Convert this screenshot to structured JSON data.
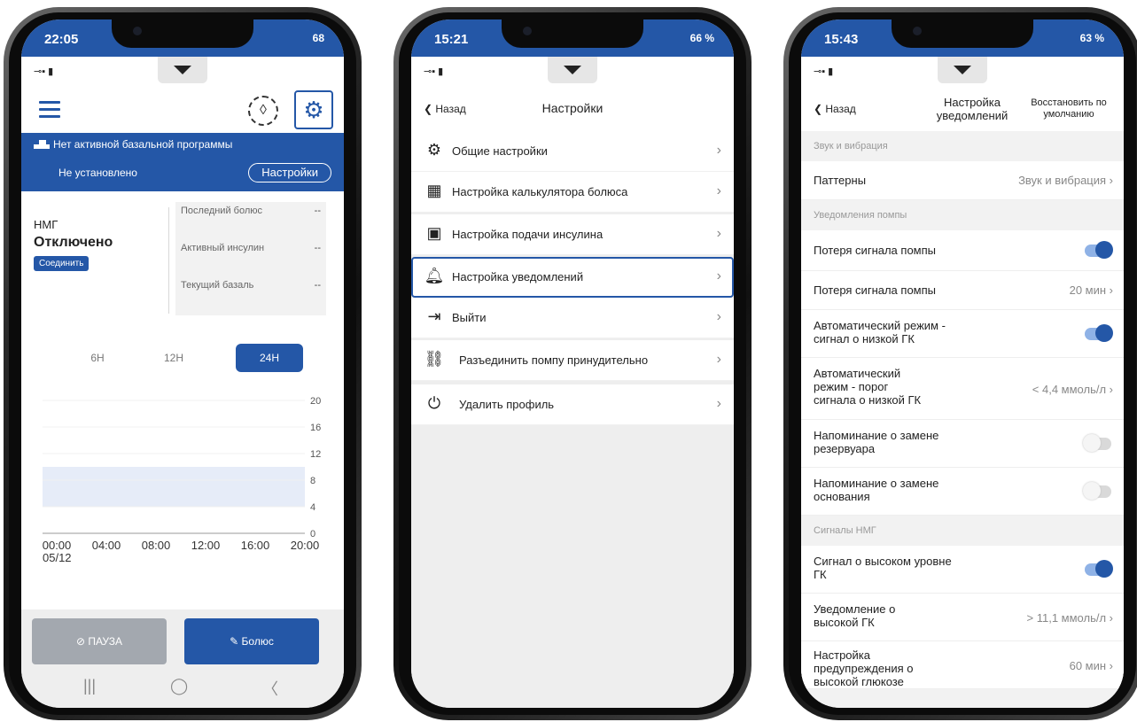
{
  "phone1": {
    "status": {
      "time": "22:05",
      "battery": "68"
    },
    "header": {
      "menu_icon": "hamburger-icon",
      "drop_icon": "drop-icon",
      "settings_icon": "gear-icon"
    },
    "banner": {
      "title": "Нет активной базальной программы",
      "status": "Не установлено",
      "button": "Настройки"
    },
    "cgm": {
      "label": "НМГ",
      "state": "Отключено",
      "connect": "Соединить"
    },
    "stats": [
      {
        "label": "Последний болюс",
        "value": "--"
      },
      {
        "label": "Активный инсулин",
        "value": "--"
      },
      {
        "label": "Текущий базаль",
        "value": "--"
      }
    ],
    "ranges": [
      "6H",
      "12H",
      "24H"
    ],
    "active_range": "24H",
    "buttons": {
      "pause": "ПАУЗА",
      "bolus": "Болюс"
    }
  },
  "chart_data": {
    "type": "area",
    "x": [
      "00:00",
      "04:00",
      "08:00",
      "12:00",
      "16:00",
      "20:00"
    ],
    "x_sublabel": "05/12",
    "y_ticks": [
      20,
      16,
      12,
      8,
      4,
      0
    ],
    "ylim": [
      0,
      20
    ],
    "target_band": [
      4,
      10
    ]
  },
  "phone2": {
    "status": {
      "time": "15:21",
      "battery": "66 %"
    },
    "back": "Назад",
    "title": "Настройки",
    "items": [
      {
        "label": "Общие настройки",
        "icon": "gear-icon"
      },
      {
        "label": "Настройка калькулятора болюса",
        "icon": "calculator-icon"
      },
      {
        "label": "Настройка подачи инсулина",
        "icon": "vial-icon"
      },
      {
        "label": "Настройка уведомлений",
        "icon": "bell-icon"
      },
      {
        "label": "Выйти",
        "icon": "logout-icon"
      },
      {
        "label": "Разъединить помпу принудительно",
        "icon": "unlink-icon"
      },
      {
        "label": "Удалить профиль",
        "icon": "power-icon"
      }
    ]
  },
  "phone3": {
    "status": {
      "time": "15:43",
      "battery": "63 %"
    },
    "back": "Назад",
    "title": "Настройка уведомлений",
    "restore": "Восстановить по умолчанию",
    "sections": {
      "sound": "Звук и вибрация",
      "pump": "Уведомления помпы",
      "cgm": "Сигналы НМГ"
    },
    "rows": [
      {
        "label": "Паттерны",
        "value": "Звук и вибрация"
      },
      {
        "label": "Потеря сигнала помпы",
        "toggle": "on"
      },
      {
        "label": "Потеря сигнала помпы",
        "value": "20 мин"
      },
      {
        "label": "Автоматический режим - сигнал о низкой ГК",
        "toggle": "on"
      },
      {
        "label": "Автоматический режим - порог сигнала о низкой ГК",
        "value": "< 4,4 ммоль/л"
      },
      {
        "label": "Напоминание о замене резервуара",
        "toggle": "off"
      },
      {
        "label": "Напоминание о замене основания",
        "toggle": "off"
      },
      {
        "label": "Сигнал о высоком уровне ГК",
        "toggle": "on"
      },
      {
        "label": "Уведомление о высокой ГК",
        "value": "> 11,1 ммоль/л"
      },
      {
        "label": "Настройка предупреждения о высокой глюкозе",
        "value": "60 мин"
      }
    ]
  }
}
